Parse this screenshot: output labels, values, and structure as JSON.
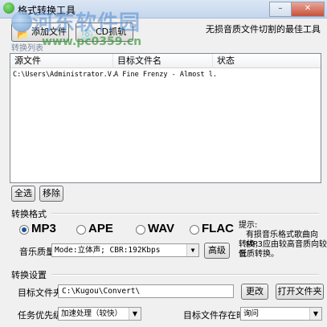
{
  "window": {
    "title": "格式转换工具",
    "buttons": {
      "minimize": "–",
      "close": "✕"
    }
  },
  "watermark": {
    "line1": "河东软件园",
    "line2": "www.pc0359.cn"
  },
  "toolbar": {
    "add_file": "添加文件",
    "add_file_icon": "add-file-icon",
    "cd_grab": "CD抓轨",
    "cd_icon": "cd-icon",
    "slogan": "无损音质文件切割的最佳工具"
  },
  "file_list": {
    "legend": "转换列表",
    "columns": [
      "源文件",
      "目标文件名",
      "状态"
    ],
    "rows": [
      {
        "source": "C:\\Users\\Administrator.V...",
        "target": "A Fine Frenzy - Almost l...",
        "status": ""
      }
    ]
  },
  "list_buttons": {
    "select_all": "全选",
    "remove": "移除"
  },
  "format_section": {
    "title": "转换格式",
    "options": [
      "MP3",
      "APE",
      "WAV",
      "FLAC"
    ],
    "selected": "MP3",
    "quality_label": "音乐质量",
    "quality_value": "Mode:立体声; CBR:192Kbps",
    "advanced": "高级",
    "hint_title": "提示:",
    "hint_lines": [
      "有损音乐格式歌曲向MP3",
      "转换，应由较高音质向较低",
      "音质转换。"
    ]
  },
  "settings_section": {
    "title": "转换设置",
    "target_folder_label": "目标文件夹",
    "target_folder_value": "C:\\Kugou\\Convert\\",
    "change": "更改",
    "open_folder": "打开文件夹",
    "priority_label": "任务优先级",
    "priority_value": "加速处理（较快）",
    "exists_label": "目标文件存在时",
    "exists_value": "询问"
  }
}
